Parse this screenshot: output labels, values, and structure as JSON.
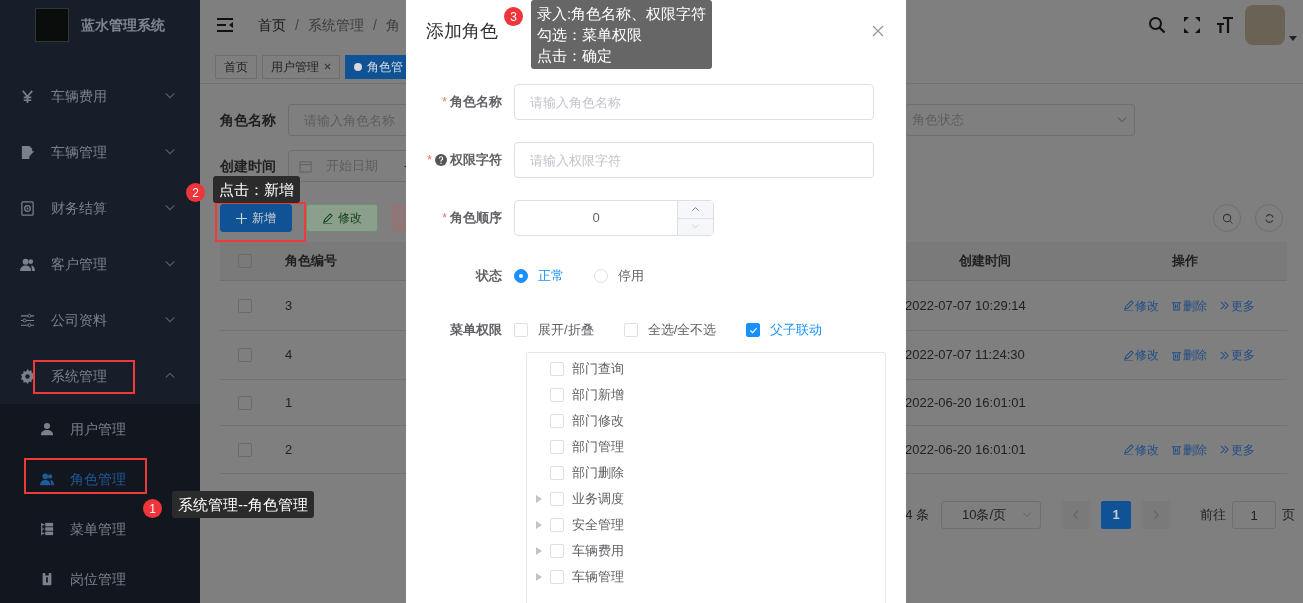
{
  "sidebar": {
    "title": "蓝水管理系统",
    "items": [
      {
        "label": "车辆费用",
        "expanded": false
      },
      {
        "label": "车辆管理",
        "expanded": false
      },
      {
        "label": "财务结算",
        "expanded": false
      },
      {
        "label": "客户管理",
        "expanded": false
      },
      {
        "label": "公司资料",
        "expanded": false
      },
      {
        "label": "系统管理",
        "expanded": true,
        "children": [
          {
            "label": "用户管理",
            "selected": false
          },
          {
            "label": "角色管理",
            "selected": true
          },
          {
            "label": "菜单管理",
            "selected": false
          },
          {
            "label": "岗位管理",
            "selected": false
          }
        ]
      }
    ]
  },
  "header": {
    "breadcrumb": [
      {
        "label": "首页"
      },
      {
        "separator": "/",
        "label": "系统管理"
      },
      {
        "separator": "/",
        "label": "角"
      }
    ]
  },
  "tags": [
    {
      "label": "首页",
      "selected": false,
      "closable": false
    },
    {
      "label": "用户管理",
      "selected": false,
      "closable": true
    },
    {
      "label": "角色管",
      "selected": true,
      "closable": false
    }
  ],
  "search_form": {
    "name_label": "角色名称",
    "name_placeholder": "请输入角色名称",
    "status_placeholder": "角色状态",
    "date_label": "创建时间",
    "date_placeholder": "开始日期",
    "date_separator": "-"
  },
  "toolbar": [
    {
      "label": "新增",
      "kind": "primary"
    },
    {
      "label": "修改",
      "kind": "success"
    },
    {
      "kind": "danger"
    }
  ],
  "table": {
    "columns": [
      "角色编号",
      "创建时间",
      "操作"
    ],
    "all_checked": false,
    "rows": [
      {
        "id": "3",
        "checked": false,
        "created": "2022-07-07 10:29:14",
        "actions": [
          "修改",
          "删除",
          "更多"
        ]
      },
      {
        "id": "4",
        "checked": false,
        "created": "2022-07-07 11:24:30",
        "actions": [
          "修改",
          "删除",
          "更多"
        ]
      },
      {
        "id": "1",
        "checked": false,
        "created": "2022-06-20 16:01:01"
      },
      {
        "id": "2",
        "checked": false,
        "created": "2022-06-20 16:01:01",
        "actions": [
          "修改",
          "删除",
          "更多"
        ]
      }
    ]
  },
  "pagination": {
    "total": "4 条",
    "page_size": "10条/页",
    "pages": [
      {
        "label": "1",
        "selected": true
      }
    ],
    "goto_label": "前往",
    "goto_value": "1",
    "goto_suffix": "页"
  },
  "dialog": {
    "title": "添加角色",
    "fields": [
      {
        "label": "角色名称",
        "required_mark": "*",
        "placeholder": "请输入角色名称"
      },
      {
        "label": "权限字符",
        "required_mark": "*",
        "help": true,
        "placeholder": "请输入权限字符"
      }
    ],
    "sort": {
      "label": "角色顺序",
      "required_mark": "*",
      "value": "0"
    },
    "status": {
      "label": "状态",
      "options": [
        {
          "label": "正常",
          "selected": true
        },
        {
          "label": "停用",
          "selected": false
        }
      ]
    },
    "menu_permissions": {
      "label": "菜单权限",
      "options": [
        {
          "label": "展开/折叠",
          "checked": false
        },
        {
          "label": "全选/全不选",
          "checked": false
        },
        {
          "label": "父子联动",
          "checked": true
        }
      ],
      "tree": [
        {
          "label": "部门查询",
          "expandable": false,
          "checked": false
        },
        {
          "label": "部门新增",
          "expandable": false,
          "checked": false
        },
        {
          "label": "部门修改",
          "expandable": false,
          "checked": false
        },
        {
          "label": "部门管理",
          "expandable": false,
          "checked": false
        },
        {
          "label": "部门删除",
          "expandable": false,
          "checked": false
        },
        {
          "label": "业务调度",
          "expandable": true,
          "checked": false
        },
        {
          "label": "安全管理",
          "expandable": true,
          "checked": false
        },
        {
          "label": "车辆费用",
          "expandable": true,
          "checked": false
        },
        {
          "label": "车辆管理",
          "expandable": true,
          "checked": false
        }
      ]
    }
  },
  "guides": [
    {
      "number": "3",
      "lines": [
        "录入:角色名称、权限字符",
        "勾选：菜单权限",
        "点击：确定"
      ]
    },
    {
      "number": "2",
      "lines": [
        "点击：新增"
      ]
    },
    {
      "number": "1",
      "lines": [
        "系统管理--角色管理"
      ]
    }
  ]
}
